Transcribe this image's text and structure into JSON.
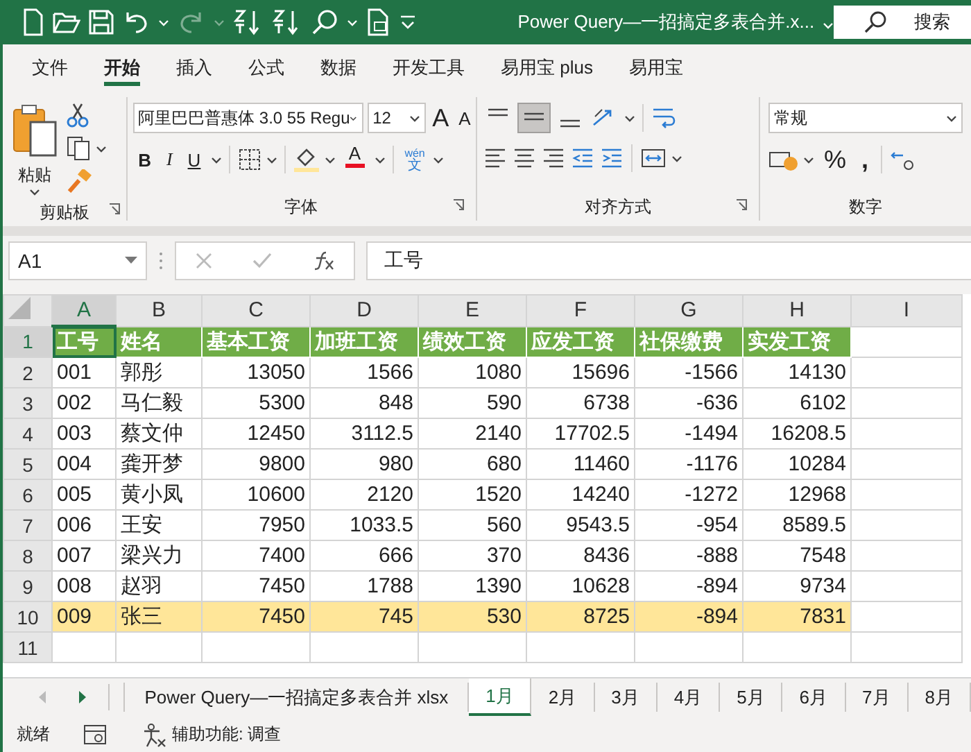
{
  "title_bar": {
    "title": "Power Query—一招搞定多表合并.x...",
    "search": {
      "placeholder": "搜索"
    }
  },
  "ribbon_tabs": [
    {
      "label": "文件",
      "selected": false
    },
    {
      "label": "开始",
      "selected": true
    },
    {
      "label": "插入",
      "selected": false
    },
    {
      "label": "公式",
      "selected": false
    },
    {
      "label": "数据",
      "selected": false
    },
    {
      "label": "开发工具",
      "selected": false
    },
    {
      "label": "易用宝 plus",
      "selected": false
    },
    {
      "label": "易用宝",
      "selected": false
    }
  ],
  "ribbon": {
    "clipboard": {
      "paste": "粘贴",
      "group": "剪贴板"
    },
    "font": {
      "font_name": "阿里巴巴普惠体 3.0 55 Regu",
      "font_size": "12",
      "grow": "A",
      "shrink": "A",
      "bold": "B",
      "italic": "I",
      "underline": "U",
      "font_color": "A",
      "phonetic_top": "wén",
      "phonetic_bottom": "文",
      "group": "字体"
    },
    "alignment": {
      "group": "对齐方式"
    },
    "number": {
      "format": "常规",
      "percent": "%",
      "comma": ",",
      "group": "数字"
    }
  },
  "formula_bar": {
    "name_box": "A1",
    "formula": "工号"
  },
  "columns": [
    {
      "label": "A",
      "selected": true
    },
    {
      "label": "B",
      "selected": false
    },
    {
      "label": "C",
      "selected": false
    },
    {
      "label": "D",
      "selected": false
    },
    {
      "label": "E",
      "selected": false
    },
    {
      "label": "F",
      "selected": false
    },
    {
      "label": "G",
      "selected": false
    },
    {
      "label": "H",
      "selected": false
    },
    {
      "label": "I",
      "selected": false
    }
  ],
  "rows": [
    {
      "number": "1",
      "kind": "header",
      "selected": true,
      "cells": [
        "工号",
        "姓名",
        "基本工资",
        "加班工资",
        "绩效工资",
        "应发工资",
        "社保缴费",
        "实发工资"
      ]
    },
    {
      "number": "2",
      "kind": "data",
      "cells": [
        "001",
        "郭彤",
        "13050",
        "1566",
        "1080",
        "15696",
        "-1566",
        "14130"
      ]
    },
    {
      "number": "3",
      "kind": "data",
      "cells": [
        "002",
        "马仁毅",
        "5300",
        "848",
        "590",
        "6738",
        "-636",
        "6102"
      ]
    },
    {
      "number": "4",
      "kind": "data",
      "cells": [
        "003",
        "蔡文仲",
        "12450",
        "3112.5",
        "2140",
        "17702.5",
        "-1494",
        "16208.5"
      ]
    },
    {
      "number": "5",
      "kind": "data",
      "cells": [
        "004",
        "龚开梦",
        "9800",
        "980",
        "680",
        "11460",
        "-1176",
        "10284"
      ]
    },
    {
      "number": "6",
      "kind": "data",
      "cells": [
        "005",
        "黄小凤",
        "10600",
        "2120",
        "1520",
        "14240",
        "-1272",
        "12968"
      ]
    },
    {
      "number": "7",
      "kind": "data",
      "cells": [
        "006",
        "王安",
        "7950",
        "1033.5",
        "560",
        "9543.5",
        "-954",
        "8589.5"
      ]
    },
    {
      "number": "8",
      "kind": "data",
      "cells": [
        "007",
        "梁兴力",
        "7400",
        "666",
        "370",
        "8436",
        "-888",
        "7548"
      ]
    },
    {
      "number": "9",
      "kind": "data",
      "cells": [
        "008",
        "赵羽",
        "7450",
        "1788",
        "1390",
        "10628",
        "-894",
        "9734"
      ]
    },
    {
      "number": "10",
      "kind": "highlight",
      "cells": [
        "009",
        "张三",
        "7450",
        "745",
        "530",
        "8725",
        "-894",
        "7831"
      ]
    },
    {
      "number": "11",
      "kind": "data",
      "cells": []
    }
  ],
  "sheet_tabs": [
    {
      "label": "Power Query—一招搞定多表合并 xlsx",
      "selected": false
    },
    {
      "label": "1月",
      "selected": true
    },
    {
      "label": "2月",
      "selected": false
    },
    {
      "label": "3月",
      "selected": false
    },
    {
      "label": "4月",
      "selected": false
    },
    {
      "label": "5月",
      "selected": false
    },
    {
      "label": "6月",
      "selected": false
    },
    {
      "label": "7月",
      "selected": false
    },
    {
      "label": "8月",
      "selected": false
    }
  ],
  "status_bar": {
    "mode": "就绪",
    "accessibility": "辅助功能: 调查"
  }
}
